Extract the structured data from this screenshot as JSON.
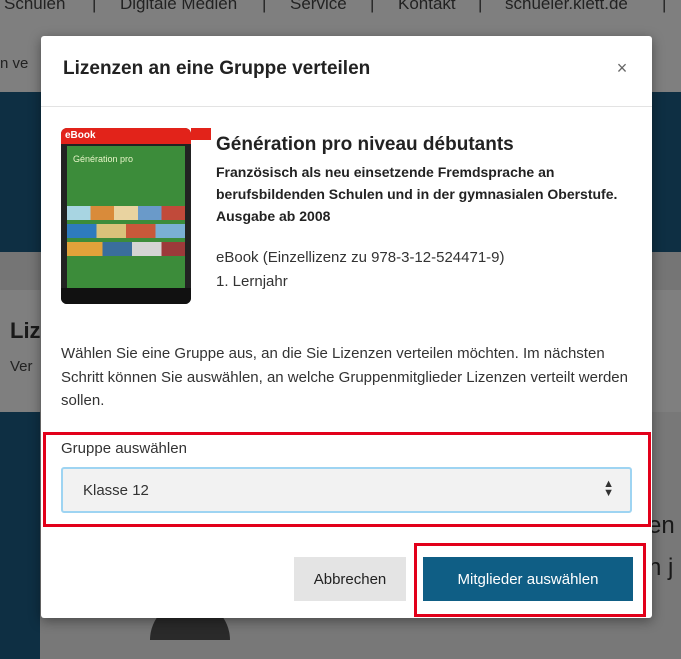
{
  "background": {
    "topnav": [
      "Schulen",
      "|",
      "Digitale Medien",
      "|",
      "Service",
      "|",
      "Kontakt",
      "|",
      "schueler.klett.de",
      "|"
    ],
    "subnav": "n ve",
    "heading": "Liz",
    "text": "Ver",
    "right_texts": [
      "en",
      "n j"
    ]
  },
  "modal": {
    "title": "Lizenzen an eine Gruppe verteilen",
    "close_label": "×",
    "product": {
      "cover_badge": "eBook",
      "cover_title": "Génération pro",
      "title": "Génération pro niveau débutants",
      "subtitle": "Französisch als neu einsetzende Fremdsprache an berufsbildenden Schulen und in der gymnasialen Oberstufe. Ausgabe ab 2008",
      "license": "eBook (Einzellizenz zu 978-3-12-524471-9)",
      "year": "1. Lernjahr"
    },
    "description": "Wählen Sie eine Gruppe aus, an die Sie Lizenzen verteilen möchten. Im nächsten Schritt können Sie auswählen, an welche Gruppenmitglieder Lizenzen verteilt werden sollen.",
    "group_select": {
      "label": "Gruppe auswählen",
      "value": "Klasse 12"
    },
    "buttons": {
      "cancel": "Abbrechen",
      "select_members": "Mitglieder auswählen"
    }
  },
  "colors": {
    "primary": "#0f5e85",
    "highlight": "#e2001a",
    "brand_red": "#e2231a"
  }
}
